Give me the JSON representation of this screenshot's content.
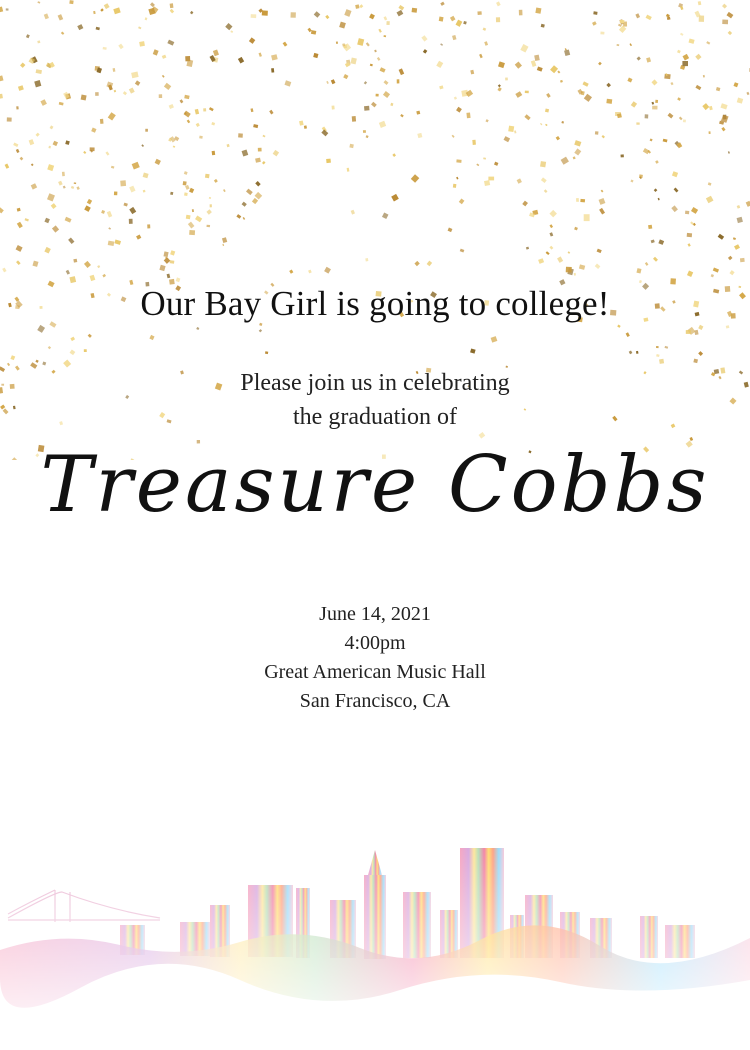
{
  "invitation": {
    "headline": "Our Bay Girl is going to college!",
    "intro_line1": "Please join us in celebrating",
    "intro_line2": "the graduation of",
    "graduate_name": "Treasure Cobbs",
    "date": "June 14, 2021",
    "time": "4:00pm",
    "venue": "Great American Music Hall",
    "location": "San Francisco, CA"
  },
  "colors": {
    "confetti": [
      "#d4a84a",
      "#e8c766",
      "#b8862e",
      "#f2d98a",
      "#c99a3c",
      "#8a6a2a"
    ],
    "skyline": [
      "#f06292",
      "#ffd54f",
      "#81c784",
      "#ba68c8",
      "#4fc3f7",
      "#ff8a65"
    ]
  }
}
